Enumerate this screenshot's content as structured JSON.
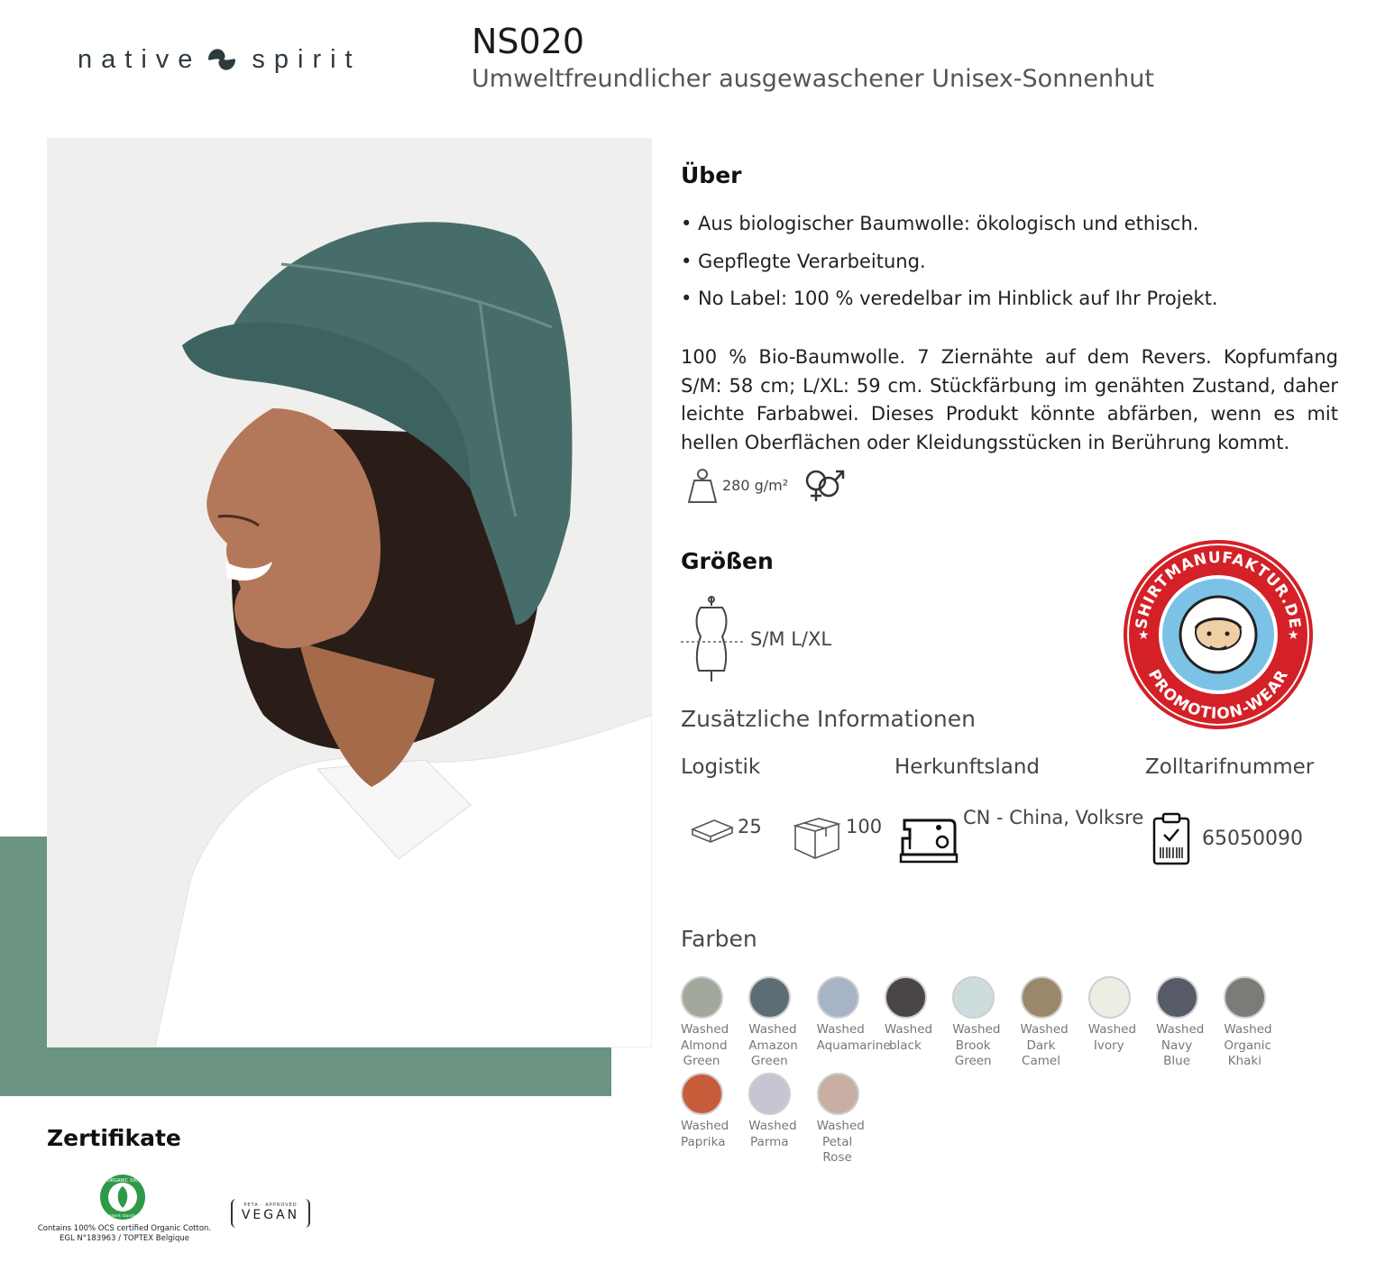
{
  "header": {
    "brand_left": "native",
    "brand_right": "spirit",
    "reference": "NS020",
    "subtitle": "Umweltfreundlicher ausgewaschener Unisex-Sonnenhut"
  },
  "about": {
    "title": "Über",
    "bullets": [
      "• Aus biologischer Baumwolle: ökologisch und ethisch.",
      "• Gepflegte Verarbeitung.",
      "• No Label: 100 % veredelbar im Hinblick auf Ihr Projekt."
    ],
    "description": "100 % Bio-Baumwolle. 7 Ziernähte auf dem Revers. Kopfumfang S/M: 58 cm; L/XL: 59 cm. Stückfärbung im genähten Zustand, daher leichte Farbabwei. Dieses Produkt könnte abfärben, wenn es mit hellen Oberflächen oder Kleidungsstücken in Berührung kommt.",
    "weight": "280 g/m²"
  },
  "sizes": {
    "title": "Größen",
    "values": "S/M L/XL"
  },
  "additional": {
    "title": "Zusätzliche Informationen",
    "logistics_label": "Logistik",
    "origin_label": "Herkunftsland",
    "customs_label": "Zolltarifnummer",
    "pack_small": "25",
    "pack_box": "100",
    "origin": "CN - China, Volksrepub",
    "customs_code": "65050090"
  },
  "colors": {
    "title": "Farben",
    "items": [
      {
        "label": "Washed Almond Green",
        "hex": "#a3a89d"
      },
      {
        "label": "Washed Amazon Green",
        "hex": "#5d6d76"
      },
      {
        "label": "Washed Aquamarine",
        "hex": "#a7b3c6"
      },
      {
        "label": "Washed black",
        "hex": "#4a4547"
      },
      {
        "label": "Washed Brook Green",
        "hex": "#cdddde"
      },
      {
        "label": "Washed Dark Camel",
        "hex": "#9b8769"
      },
      {
        "label": "Washed Ivory",
        "hex": "#eeede4"
      },
      {
        "label": "Washed Navy Blue",
        "hex": "#565b67"
      },
      {
        "label": "Washed Organic Khaki",
        "hex": "#7b7b78"
      },
      {
        "label": "Washed Paprika",
        "hex": "#c75c3a"
      },
      {
        "label": "Washed Parma",
        "hex": "#c5c5d3"
      },
      {
        "label": "Washed Petal Rose",
        "hex": "#c9aea3"
      }
    ]
  },
  "badge": {
    "top_text": "SHIRTMANUFAKTUR.DE",
    "bottom_text": "PROMOTION-WEAR"
  },
  "certificates": {
    "title": "Zertifikate",
    "ocs_line1": "Contains 100% OCS certified Organic Cotton.",
    "ocs_line2": "EGL N°183963 / TOPTEX Belgique",
    "ocs_seal_top": "ORGANIC 100",
    "ocs_seal_bottom": "content standard",
    "vegan_small": "PETA · APPROVED",
    "vegan": "VEGAN"
  },
  "accent_color": "#6b9483"
}
